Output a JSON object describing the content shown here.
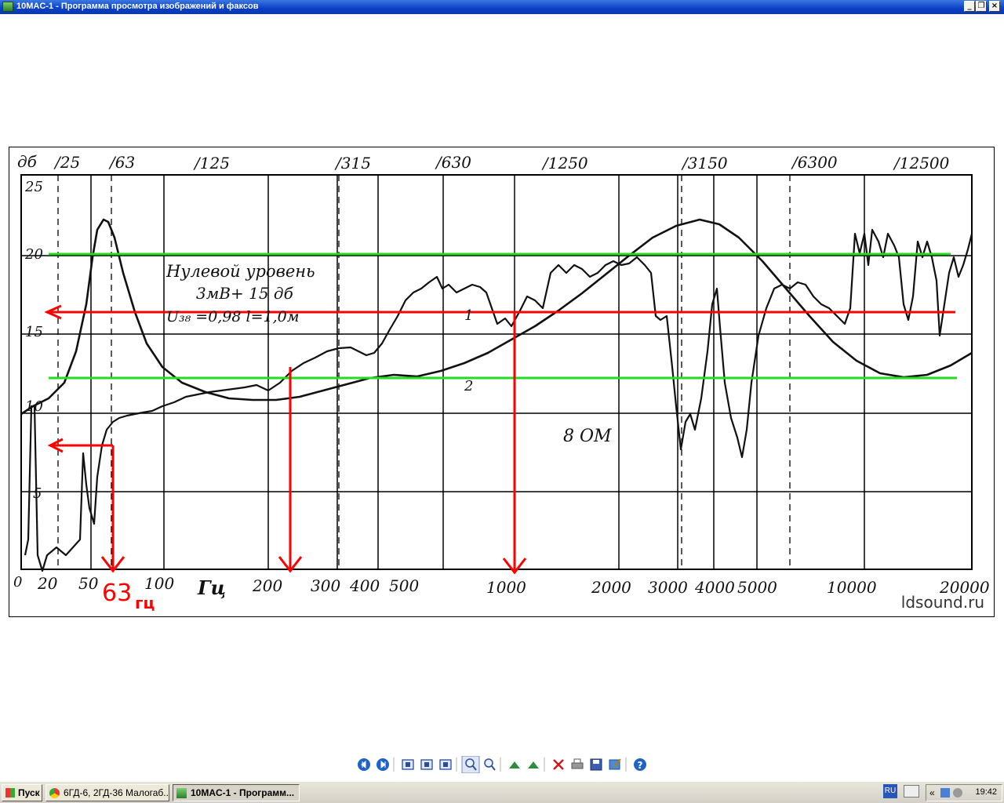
{
  "window": {
    "title": "10MAC-1 - Программа просмотра изображений и факсов",
    "controls": [
      "_",
      "❐",
      "×"
    ]
  },
  "chart": {
    "top_labels": [
      "дб",
      "/25",
      "/63",
      "/125",
      "/315",
      "/630",
      "/1250",
      "/3150",
      "/6300",
      "/12500"
    ],
    "y_ticks": [
      "25",
      "20",
      "15",
      "10",
      "5",
      "0"
    ],
    "x_ticks": [
      "20",
      "50",
      "100",
      "200",
      "300",
      "400",
      "500",
      "1000",
      "2000",
      "3000",
      "4000",
      "5000",
      "10000",
      "20000"
    ],
    "x_unit": "Гц",
    "annotation_line1": "Нулевой уровень",
    "annotation_line2": "3мВ+ 15  дб",
    "annotation_line3": "U₃₈ =0,98  l=1,0м",
    "curve1_label": "1",
    "curve2_label": "2",
    "impedance_label": "8 ОМ",
    "overlay_label_num": "63",
    "overlay_label_unit": "гц",
    "colors": {
      "grid": "#000000",
      "curve": "#111111",
      "overlay_red": "#ff0000",
      "overlay_green": "#22dd22"
    }
  },
  "watermark": "ldsound.ru",
  "viewer_toolbar": {
    "buttons": [
      "prev-image-icon",
      "next-image-icon",
      "best-fit-icon",
      "actual-size-icon",
      "slideshow-icon",
      "zoom-in-icon",
      "zoom-out-icon",
      "rotate-clockwise-icon",
      "rotate-counterclockwise-icon",
      "delete-icon",
      "print-icon",
      "save-icon",
      "edit-icon",
      "help-icon"
    ]
  },
  "taskbar": {
    "start_label": "Пуск",
    "tasks": [
      {
        "label": "6ГД-6, 2ГД-36 Малогаб...",
        "active": false
      },
      {
        "label": "10MAC-1 - Программ...",
        "active": true
      }
    ],
    "lang": "RU",
    "tray_chevron": "«",
    "clock": "19:42"
  }
}
